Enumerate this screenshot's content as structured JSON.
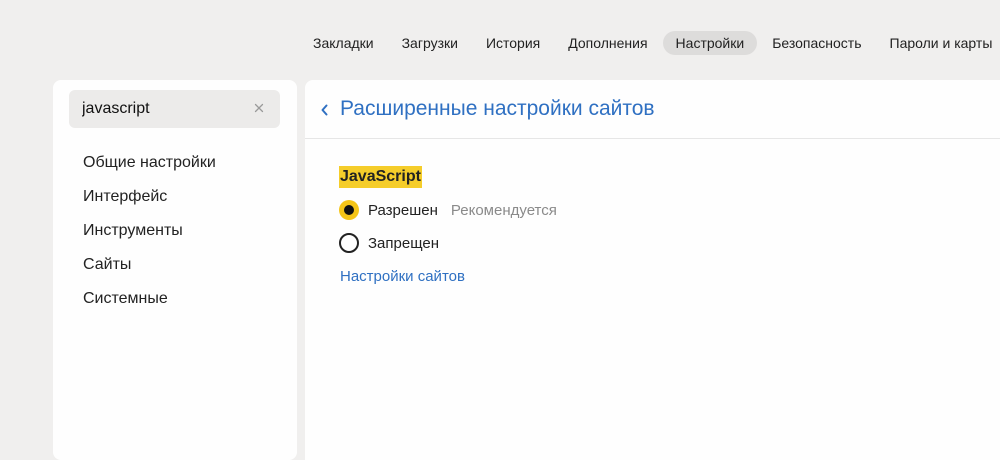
{
  "topnav": {
    "tabs": [
      {
        "label": "Закладки"
      },
      {
        "label": "Загрузки"
      },
      {
        "label": "История"
      },
      {
        "label": "Дополнения"
      },
      {
        "label": "Настройки",
        "active": true
      },
      {
        "label": "Безопасность"
      },
      {
        "label": "Пароли и карты"
      }
    ]
  },
  "sidebar": {
    "search": {
      "value": "javascript",
      "clear_icon": "close-icon"
    },
    "items": [
      {
        "label": "Общие настройки"
      },
      {
        "label": "Интерфейс"
      },
      {
        "label": "Инструменты"
      },
      {
        "label": "Сайты"
      },
      {
        "label": "Системные"
      }
    ]
  },
  "main": {
    "back_icon": "chevron-left-icon",
    "title": "Расширенные настройки сайтов",
    "section_title": "JavaScript",
    "options": [
      {
        "label": "Разрешен",
        "hint": "Рекомендуется",
        "checked": true
      },
      {
        "label": "Запрещен",
        "checked": false
      }
    ],
    "link": "Настройки сайтов"
  },
  "colors": {
    "background": "#f0efee",
    "panel": "#fefefe",
    "accent_link": "#2f70c2",
    "highlight": "#f5cd2a",
    "radio_selected": "#f5c518",
    "active_tab": "#dddcdb"
  }
}
